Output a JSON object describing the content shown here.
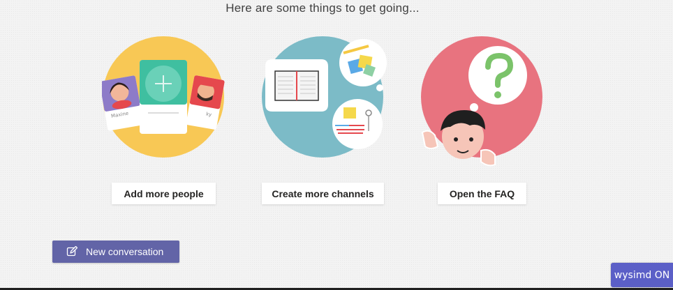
{
  "heading": "Here are some things to get going...",
  "actions": {
    "add_people": "Add more people",
    "create_channels": "Create more channels",
    "open_faq": "Open the FAQ"
  },
  "illustrations": {
    "people_card_left_name": "Maxine",
    "people_card_right_name": "ky"
  },
  "new_conversation": {
    "label": "New conversation",
    "icon": "compose-icon"
  },
  "badge": "wysimd ON",
  "colors": {
    "accent": "#6264a7",
    "people_circle": "#f8c855",
    "channels_circle": "#7cbbc7",
    "faq_circle": "#e8737f"
  }
}
